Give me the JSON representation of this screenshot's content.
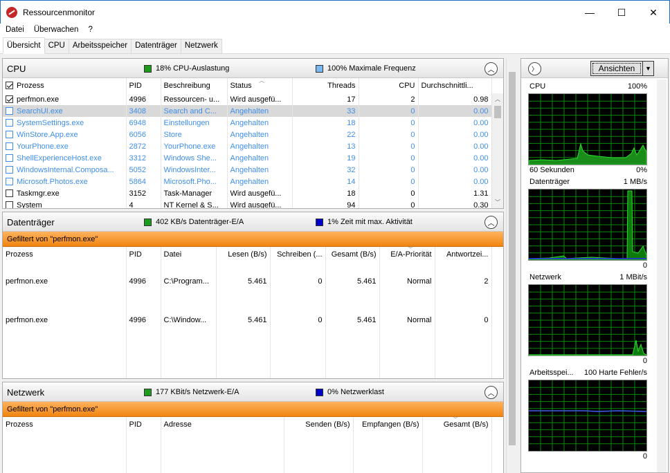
{
  "window": {
    "title": "Ressourcenmonitor",
    "minimize": "—",
    "maximize": "☐",
    "close": "✕"
  },
  "menu": [
    "Datei",
    "Überwachen",
    "?"
  ],
  "tabs": [
    "Übersicht",
    "CPU",
    "Arbeitsspeicher",
    "Datenträger",
    "Netzwerk"
  ],
  "cpu": {
    "title": "CPU",
    "stat1": "18% CPU-Auslastung",
    "stat1_color": "#1e9b1e",
    "stat2": "100% Maximale Frequenz",
    "stat2_color": "#7ab9f0",
    "headers": [
      "Prozess",
      "PID",
      "Beschreibung",
      "Status",
      "Threads",
      "CPU",
      "Durchschnittli..."
    ],
    "rows": [
      {
        "name": "perfmon.exe",
        "pid": "4996",
        "desc": "Ressourcen- u...",
        "status": "Wird ausgefü...",
        "threads": "17",
        "cpu": "2",
        "avg": "0.98",
        "checked": true,
        "suspended": false,
        "selected": false
      },
      {
        "name": "SearchUI.exe",
        "pid": "3408",
        "desc": "Search and C...",
        "status": "Angehalten",
        "threads": "33",
        "cpu": "0",
        "avg": "0.00",
        "checked": false,
        "suspended": true,
        "selected": true
      },
      {
        "name": "SystemSettings.exe",
        "pid": "6948",
        "desc": "Einstellungen",
        "status": "Angehalten",
        "threads": "18",
        "cpu": "0",
        "avg": "0.00",
        "checked": false,
        "suspended": true,
        "selected": false
      },
      {
        "name": "WinStore.App.exe",
        "pid": "6056",
        "desc": "Store",
        "status": "Angehalten",
        "threads": "22",
        "cpu": "0",
        "avg": "0.00",
        "checked": false,
        "suspended": true,
        "selected": false
      },
      {
        "name": "YourPhone.exe",
        "pid": "2872",
        "desc": "YourPhone.exe",
        "status": "Angehalten",
        "threads": "13",
        "cpu": "0",
        "avg": "0.00",
        "checked": false,
        "suspended": true,
        "selected": false
      },
      {
        "name": "ShellExperienceHost.exe",
        "pid": "3312",
        "desc": "Windows She...",
        "status": "Angehalten",
        "threads": "19",
        "cpu": "0",
        "avg": "0.00",
        "checked": false,
        "suspended": true,
        "selected": false
      },
      {
        "name": "WindowsInternal.Composa...",
        "pid": "5052",
        "desc": "WindowsInter...",
        "status": "Angehalten",
        "threads": "32",
        "cpu": "0",
        "avg": "0.00",
        "checked": false,
        "suspended": true,
        "selected": false
      },
      {
        "name": "Microsoft.Photos.exe",
        "pid": "5864",
        "desc": "Microsoft.Pho...",
        "status": "Angehalten",
        "threads": "14",
        "cpu": "0",
        "avg": "0.00",
        "checked": false,
        "suspended": true,
        "selected": false
      },
      {
        "name": "Taskmgr.exe",
        "pid": "3152",
        "desc": "Task-Manager",
        "status": "Wird ausgefü...",
        "threads": "18",
        "cpu": "0",
        "avg": "1.31",
        "checked": false,
        "suspended": false,
        "selected": false
      },
      {
        "name": "System",
        "pid": "4",
        "desc": "NT Kernel & S...",
        "status": "Wird ausgefü...",
        "threads": "94",
        "cpu": "0",
        "avg": "0.30",
        "checked": false,
        "suspended": false,
        "selected": false
      }
    ]
  },
  "disk": {
    "title": "Datenträger",
    "stat1": "402 KB/s Datenträger-E/A",
    "stat1_color": "#1e9b1e",
    "stat2": "1% Zeit mit max. Aktivität",
    "stat2_color": "#0000c8",
    "filter": "Gefiltert von \"perfmon.exe\"",
    "headers": [
      "Prozess",
      "PID",
      "Datei",
      "Lesen (B/s)",
      "Schreiben (...",
      "Gesamt (B/s)",
      "E/A-Priorität",
      "Antwortzei..."
    ],
    "rows": [
      {
        "name": "perfmon.exe",
        "pid": "4996",
        "file": "C:\\Program...",
        "read": "5.461",
        "write": "0",
        "total": "5.461",
        "prio": "Normal",
        "resp": "2"
      },
      {
        "name": "perfmon.exe",
        "pid": "4996",
        "file": "C:\\Window...",
        "read": "5.461",
        "write": "0",
        "total": "5.461",
        "prio": "Normal",
        "resp": "0"
      }
    ]
  },
  "network": {
    "title": "Netzwerk",
    "stat1": "177 KBit/s Netzwerk-E/A",
    "stat1_color": "#1e9b1e",
    "stat2": "0% Netzwerklast",
    "stat2_color": "#0000c8",
    "filter": "Gefiltert von \"perfmon.exe\"",
    "headers": [
      "Prozess",
      "PID",
      "Adresse",
      "Senden (B/s)",
      "Empfangen (B/s)",
      "Gesamt (B/s)"
    ]
  },
  "right": {
    "views_button": "Ansichten",
    "graphs": [
      {
        "label": "CPU",
        "max": "100%",
        "footer_left": "60 Sekunden",
        "footer_right": "0%"
      },
      {
        "label": "Datenträger",
        "max": "1 MB/s",
        "footer_left": "",
        "footer_right": "0"
      },
      {
        "label": "Netzwerk",
        "max": "1 MBit/s",
        "footer_left": "",
        "footer_right": "0"
      },
      {
        "label": "Arbeitsspei...",
        "max": "100 Harte Fehler/s",
        "footer_left": "",
        "footer_right": "0"
      }
    ]
  }
}
